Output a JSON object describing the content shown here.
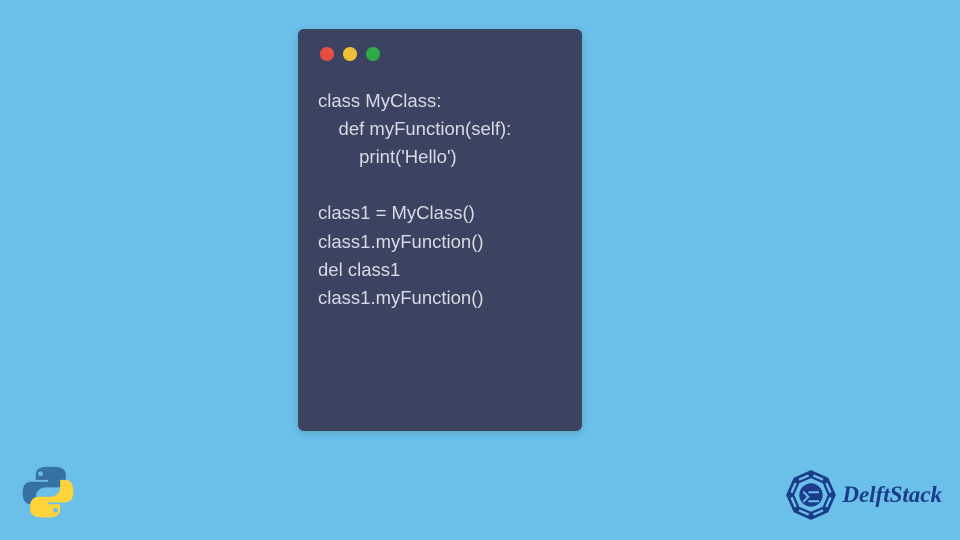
{
  "code": {
    "lines": [
      "class MyClass:",
      "    def myFunction(self):",
      "        print('Hello')",
      "",
      "class1 = MyClass()",
      "class1.myFunction()",
      "del class1",
      "class1.myFunction()"
    ]
  },
  "branding": {
    "name": "DelftStack"
  },
  "colors": {
    "background": "#6ac0e8",
    "window": "#3b4360",
    "codeText": "#d8dbe4",
    "dotRed": "#e84e40",
    "dotYellow": "#f0bf3a",
    "dotGreen": "#2faa4b",
    "brandText": "#1a3c8a"
  }
}
